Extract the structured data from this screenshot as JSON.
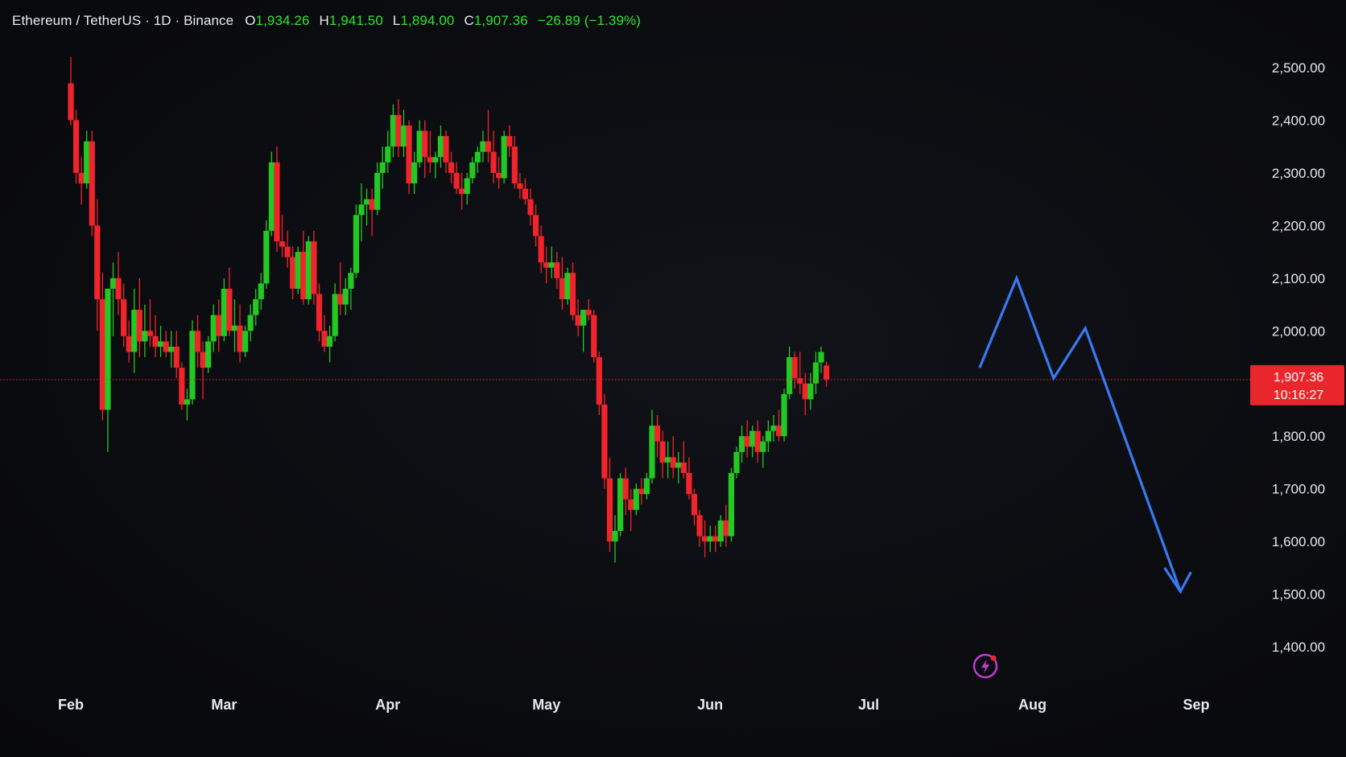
{
  "legend": {
    "symbol": "Ethereum / TetherUS · 1D · Binance",
    "open_key": "O",
    "open": "1,934.26",
    "high_key": "H",
    "high": "1,941.50",
    "low_key": "L",
    "low": "1,894.00",
    "close_key": "C",
    "close": "1,907.36",
    "change": "−26.89 (−1.39%)"
  },
  "colors": {
    "up": "#22c922",
    "down": "#f0242a",
    "price_line": "#f0242a",
    "forecast": "#3a78f2",
    "axis_text": "#e6e8ee",
    "legend_value": "#2ee62e",
    "price_label_bg": "#e8262b",
    "alert_icon": "#c33ad8"
  },
  "price_label": {
    "price": "1,907.36",
    "countdown": "10:16:27"
  },
  "icons": {
    "alert": "lightning-alert-icon"
  },
  "chart_data": {
    "type": "candlestick",
    "title": "Ethereum / TetherUS · 1D · Binance",
    "ylim": [
      1340,
      2580
    ],
    "y_ticks": [
      "2,500.00",
      "2,400.00",
      "2,300.00",
      "2,200.00",
      "2,100.00",
      "2,000.00",
      "1,800.00",
      "1,700.00",
      "1,600.00",
      "1,500.00",
      "1,400.00"
    ],
    "y_tick_values": [
      2500,
      2400,
      2300,
      2200,
      2100,
      2000,
      1800,
      1700,
      1600,
      1500,
      1400
    ],
    "x_ticks": [
      "Feb",
      "Mar",
      "Apr",
      "May",
      "Jun",
      "Jul",
      "Aug",
      "Sep"
    ],
    "x_tick_dates": [
      "2024-02-01",
      "2024-03-01",
      "2024-04-01",
      "2024-05-01",
      "2024-06-01",
      "2024-07-01",
      "2024-08-01",
      "2024-09-01"
    ],
    "xlim": [
      "2024-01-23",
      "2024-09-11"
    ],
    "current_price": 1907.36,
    "grid": false,
    "series": [
      {
        "type": "candlestick",
        "start_date": "2024-02-01",
        "ohlc": [
          [
            2470,
            2520,
            2390,
            2400
          ],
          [
            2400,
            2420,
            2280,
            2300
          ],
          [
            2300,
            2330,
            2240,
            2280
          ],
          [
            2280,
            2380,
            2270,
            2360
          ],
          [
            2360,
            2380,
            2180,
            2200
          ],
          [
            2200,
            2250,
            2000,
            2060
          ],
          [
            2060,
            2110,
            1830,
            1850
          ],
          [
            1850,
            2080,
            1770,
            2080
          ],
          [
            2080,
            2130,
            1990,
            2100
          ],
          [
            2100,
            2150,
            2030,
            2060
          ],
          [
            2060,
            2090,
            1970,
            1990
          ],
          [
            1990,
            2020,
            1940,
            1960
          ],
          [
            1960,
            2080,
            1920,
            2040
          ],
          [
            2040,
            2100,
            1950,
            1980
          ],
          [
            1980,
            2050,
            1950,
            2000
          ],
          [
            2000,
            2060,
            1970,
            1990
          ],
          [
            1990,
            2030,
            1950,
            1970
          ],
          [
            1970,
            2010,
            1950,
            1980
          ],
          [
            1980,
            2000,
            1950,
            1960
          ],
          [
            1960,
            2000,
            1930,
            1970
          ],
          [
            1970,
            2000,
            1910,
            1930
          ],
          [
            1930,
            1940,
            1850,
            1860
          ],
          [
            1860,
            1890,
            1830,
            1870
          ],
          [
            1870,
            2020,
            1860,
            2000
          ],
          [
            2000,
            2030,
            1930,
            1960
          ],
          [
            1960,
            1980,
            1870,
            1930
          ],
          [
            1930,
            1990,
            1920,
            1980
          ],
          [
            1980,
            2050,
            1960,
            2030
          ],
          [
            2030,
            2060,
            1960,
            1990
          ],
          [
            1990,
            2100,
            1980,
            2080
          ],
          [
            2080,
            2120,
            1990,
            2000
          ],
          [
            2000,
            2060,
            1960,
            2010
          ],
          [
            2010,
            2050,
            1940,
            1960
          ],
          [
            1960,
            2010,
            1950,
            2000
          ],
          [
            2000,
            2050,
            1980,
            2030
          ],
          [
            2030,
            2080,
            2010,
            2060
          ],
          [
            2060,
            2110,
            2040,
            2090
          ],
          [
            2090,
            2210,
            2080,
            2190
          ],
          [
            2190,
            2340,
            2180,
            2320
          ],
          [
            2320,
            2350,
            2150,
            2170
          ],
          [
            2170,
            2220,
            2140,
            2160
          ],
          [
            2160,
            2190,
            2120,
            2140
          ],
          [
            2140,
            2160,
            2060,
            2080
          ],
          [
            2080,
            2160,
            2070,
            2150
          ],
          [
            2150,
            2190,
            2050,
            2060
          ],
          [
            2060,
            2180,
            2050,
            2170
          ],
          [
            2170,
            2190,
            2050,
            2070
          ],
          [
            2070,
            2090,
            1980,
            2000
          ],
          [
            2000,
            2030,
            1960,
            1970
          ],
          [
            1970,
            2010,
            1940,
            1990
          ],
          [
            1990,
            2090,
            1980,
            2070
          ],
          [
            2070,
            2130,
            2030,
            2050
          ],
          [
            2050,
            2100,
            2030,
            2080
          ],
          [
            2080,
            2120,
            2040,
            2110
          ],
          [
            2110,
            2240,
            2100,
            2220
          ],
          [
            2220,
            2280,
            2170,
            2240
          ],
          [
            2240,
            2270,
            2200,
            2250
          ],
          [
            2250,
            2270,
            2180,
            2230
          ],
          [
            2230,
            2320,
            2220,
            2300
          ],
          [
            2300,
            2350,
            2270,
            2320
          ],
          [
            2320,
            2380,
            2300,
            2350
          ],
          [
            2350,
            2430,
            2330,
            2410
          ],
          [
            2410,
            2440,
            2330,
            2350
          ],
          [
            2350,
            2420,
            2330,
            2390
          ],
          [
            2390,
            2400,
            2260,
            2280
          ],
          [
            2280,
            2340,
            2260,
            2320
          ],
          [
            2320,
            2400,
            2310,
            2380
          ],
          [
            2380,
            2400,
            2290,
            2330
          ],
          [
            2330,
            2380,
            2300,
            2320
          ],
          [
            2320,
            2340,
            2290,
            2330
          ],
          [
            2330,
            2390,
            2310,
            2370
          ],
          [
            2370,
            2380,
            2300,
            2320
          ],
          [
            2320,
            2340,
            2280,
            2300
          ],
          [
            2300,
            2320,
            2260,
            2270
          ],
          [
            2270,
            2300,
            2230,
            2260
          ],
          [
            2260,
            2300,
            2240,
            2290
          ],
          [
            2290,
            2330,
            2280,
            2320
          ],
          [
            2320,
            2350,
            2300,
            2340
          ],
          [
            2340,
            2380,
            2320,
            2360
          ],
          [
            2360,
            2420,
            2320,
            2340
          ],
          [
            2340,
            2380,
            2280,
            2300
          ],
          [
            2300,
            2330,
            2270,
            2290
          ],
          [
            2290,
            2380,
            2280,
            2370
          ],
          [
            2370,
            2390,
            2330,
            2350
          ],
          [
            2350,
            2370,
            2270,
            2280
          ],
          [
            2280,
            2300,
            2250,
            2270
          ],
          [
            2270,
            2290,
            2240,
            2250
          ],
          [
            2250,
            2270,
            2200,
            2220
          ],
          [
            2220,
            2240,
            2160,
            2180
          ],
          [
            2180,
            2200,
            2110,
            2130
          ],
          [
            2130,
            2160,
            2090,
            2120
          ],
          [
            2120,
            2160,
            2100,
            2130
          ],
          [
            2130,
            2150,
            2080,
            2100
          ],
          [
            2100,
            2140,
            2040,
            2060
          ],
          [
            2060,
            2120,
            2050,
            2110
          ],
          [
            2110,
            2130,
            2020,
            2030
          ],
          [
            2030,
            2060,
            1990,
            2010
          ],
          [
            2010,
            2030,
            1960,
            2040
          ],
          [
            2040,
            2060,
            2020,
            2030
          ],
          [
            2030,
            2040,
            1940,
            1950
          ],
          [
            1950,
            1960,
            1840,
            1860
          ],
          [
            1860,
            1880,
            1700,
            1720
          ],
          [
            1720,
            1760,
            1580,
            1600
          ],
          [
            1600,
            1650,
            1560,
            1620
          ],
          [
            1620,
            1730,
            1610,
            1720
          ],
          [
            1720,
            1740,
            1650,
            1680
          ],
          [
            1680,
            1700,
            1620,
            1660
          ],
          [
            1660,
            1710,
            1650,
            1700
          ],
          [
            1700,
            1720,
            1670,
            1690
          ],
          [
            1690,
            1730,
            1680,
            1720
          ],
          [
            1720,
            1850,
            1710,
            1820
          ],
          [
            1820,
            1840,
            1760,
            1790
          ],
          [
            1790,
            1810,
            1720,
            1750
          ],
          [
            1750,
            1790,
            1720,
            1760
          ],
          [
            1760,
            1800,
            1720,
            1740
          ],
          [
            1740,
            1770,
            1710,
            1750
          ],
          [
            1750,
            1790,
            1720,
            1730
          ],
          [
            1730,
            1760,
            1680,
            1690
          ],
          [
            1690,
            1700,
            1630,
            1650
          ],
          [
            1650,
            1660,
            1590,
            1610
          ],
          [
            1610,
            1640,
            1570,
            1600
          ],
          [
            1600,
            1630,
            1580,
            1610
          ],
          [
            1610,
            1630,
            1580,
            1600
          ],
          [
            1600,
            1650,
            1590,
            1640
          ],
          [
            1640,
            1670,
            1590,
            1610
          ],
          [
            1610,
            1740,
            1600,
            1730
          ],
          [
            1730,
            1780,
            1720,
            1770
          ],
          [
            1770,
            1820,
            1750,
            1800
          ],
          [
            1800,
            1830,
            1760,
            1780
          ],
          [
            1780,
            1820,
            1760,
            1810
          ],
          [
            1810,
            1830,
            1750,
            1770
          ],
          [
            1770,
            1800,
            1740,
            1790
          ],
          [
            1790,
            1830,
            1770,
            1810
          ],
          [
            1810,
            1840,
            1790,
            1820
          ],
          [
            1820,
            1850,
            1790,
            1800
          ],
          [
            1800,
            1890,
            1790,
            1880
          ],
          [
            1880,
            1970,
            1870,
            1950
          ],
          [
            1950,
            1960,
            1890,
            1910
          ],
          [
            1910,
            1960,
            1880,
            1900
          ],
          [
            1900,
            1920,
            1840,
            1870
          ],
          [
            1870,
            1920,
            1850,
            1900
          ],
          [
            1900,
            1960,
            1880,
            1940
          ],
          [
            1940,
            1970,
            1920,
            1960
          ],
          [
            1934.26,
            1941.5,
            1894,
            1907.36
          ]
        ]
      }
    ],
    "projection": {
      "color": "#3a78f2",
      "points": [
        [
          "2024-07-22",
          1930
        ],
        [
          "2024-07-29",
          2100
        ],
        [
          "2024-08-05",
          1910
        ],
        [
          "2024-08-11",
          2005
        ],
        [
          "2024-08-29",
          1505
        ]
      ],
      "arrowhead": [
        [
          "2024-08-26",
          1550
        ],
        [
          "2024-08-29",
          1505
        ],
        [
          "2024-08-31",
          1542
        ]
      ]
    }
  }
}
